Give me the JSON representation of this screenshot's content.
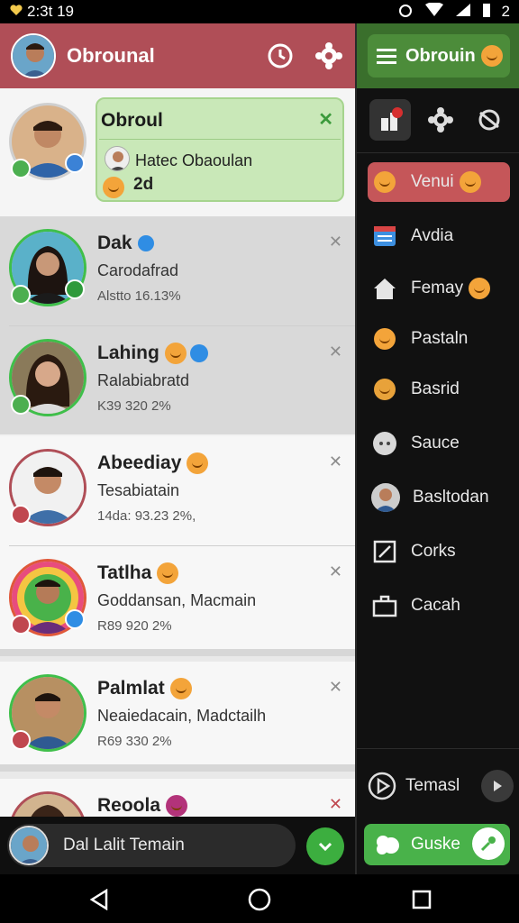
{
  "status": {
    "time": "2:3t 19",
    "battery": "2"
  },
  "header": {
    "title": "Obrounal"
  },
  "list": {
    "first": {
      "card_title": "Obroul",
      "card_name": "Hatec Obaoulan",
      "card_time": "2d"
    },
    "rows": [
      {
        "name": "Dak",
        "sub": "Carodafrad",
        "meta": "Alstto 16.13%"
      },
      {
        "name": "Lahing",
        "sub": "Ralabiabratd",
        "meta": "K39 320 2%"
      },
      {
        "name": "Abeediay",
        "sub": "Tesabiatain",
        "meta": "14da: 93.23 2%,"
      },
      {
        "name": "Tatlha",
        "sub": "Goddansan,  Macmain",
        "meta": "R89 920 2%"
      },
      {
        "name": "Palmlat",
        "sub": "Neaiedacain,  Madctailh",
        "meta": "R69 330 2%"
      },
      {
        "name": "Reoola"
      }
    ]
  },
  "bottom": {
    "label": "Dal Lalit Temain"
  },
  "drawer": {
    "title": "Obrouin",
    "items": [
      "Venui",
      "Avdia",
      "Femay",
      "Pastaln",
      "Basrid",
      "Sauce",
      "Basltodan",
      "Corks",
      "Cacah"
    ],
    "footer": "Temasl",
    "button": "Guske"
  },
  "colors": {
    "header_red": "#b04e57",
    "drawer_green": "#3a6f2c",
    "active_item": "#c55659",
    "accent_green": "#49b24a"
  }
}
